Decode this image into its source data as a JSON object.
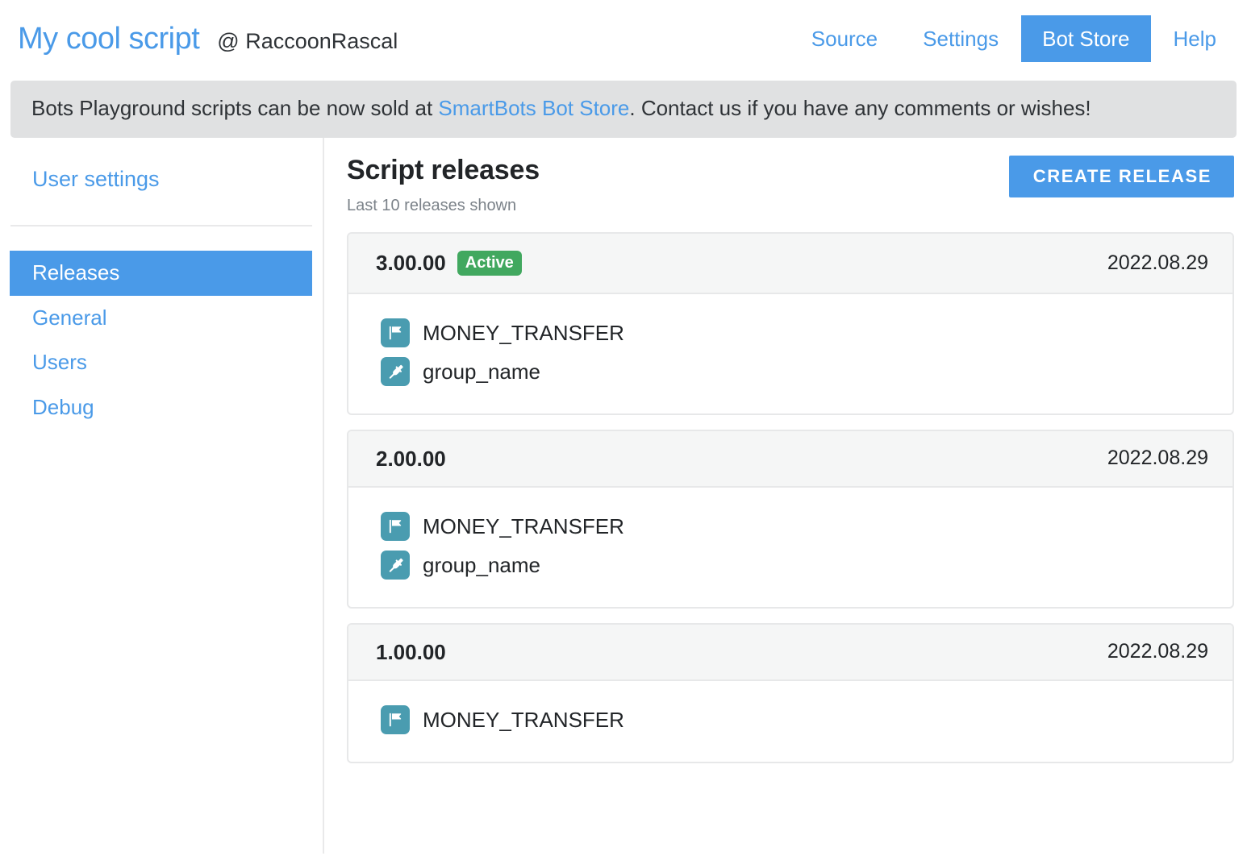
{
  "header": {
    "script_title": "My cool script",
    "owner": "@ RaccoonRascal",
    "nav": [
      {
        "label": "Source",
        "active": false
      },
      {
        "label": "Settings",
        "active": false
      },
      {
        "label": "Bot Store",
        "active": true
      },
      {
        "label": "Help",
        "active": false
      }
    ]
  },
  "notice": {
    "before": "Bots Playground scripts can be now sold at ",
    "link": "SmartBots Bot Store",
    "after": ". Contact us if you have any comments or wishes!"
  },
  "sidebar": {
    "heading": "User settings",
    "items": [
      {
        "label": "Releases",
        "active": true
      },
      {
        "label": "General",
        "active": false
      },
      {
        "label": "Users",
        "active": false
      },
      {
        "label": "Debug",
        "active": false
      }
    ]
  },
  "main": {
    "title": "Script releases",
    "subtitle": "Last 10 releases shown",
    "create_button": "CREATE RELEASE",
    "releases": [
      {
        "version": "3.00.00",
        "badge": "Active",
        "date": "2022.08.29",
        "resources": [
          {
            "icon": "flag-icon",
            "label": "MONEY_TRANSFER"
          },
          {
            "icon": "plug-icon",
            "label": "group_name"
          }
        ]
      },
      {
        "version": "2.00.00",
        "badge": null,
        "date": "2022.08.29",
        "resources": [
          {
            "icon": "flag-icon",
            "label": "MONEY_TRANSFER"
          },
          {
            "icon": "plug-icon",
            "label": "group_name"
          }
        ]
      },
      {
        "version": "1.00.00",
        "badge": null,
        "date": "2022.08.29",
        "resources": [
          {
            "icon": "flag-icon",
            "label": "MONEY_TRANSFER"
          }
        ]
      }
    ]
  },
  "colors": {
    "accent_blue": "#4a9ae8",
    "badge_green": "#41a85f",
    "icon_teal": "#4a9cb0",
    "banner_gray": "#e0e1e2"
  }
}
